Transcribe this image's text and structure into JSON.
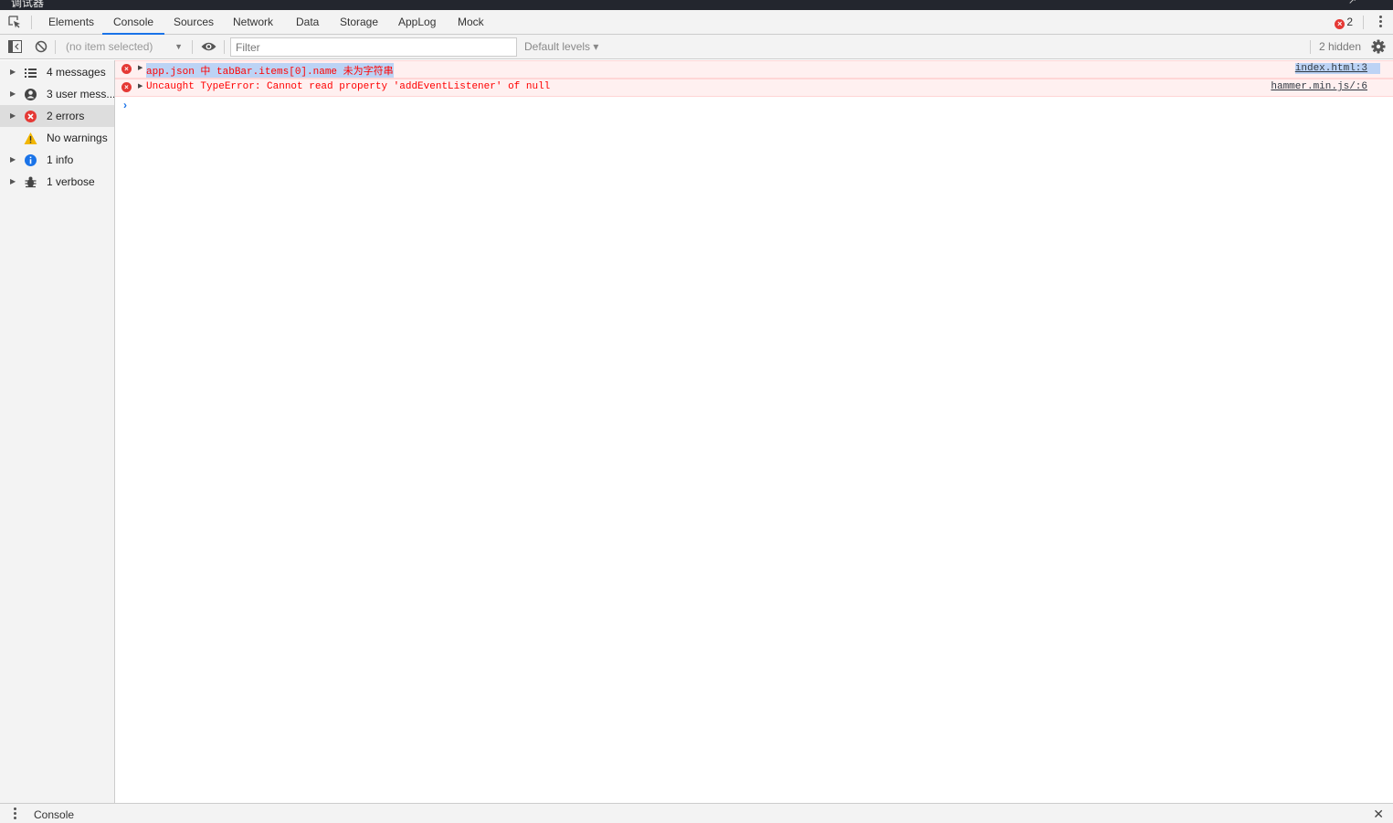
{
  "window": {
    "title": "调试器",
    "corner_glyph": "↗"
  },
  "tabs": [
    {
      "label": "Elements"
    },
    {
      "label": "Console"
    },
    {
      "label": "Sources"
    },
    {
      "label": "Network"
    },
    {
      "label": "Data"
    },
    {
      "label": "Storage"
    },
    {
      "label": "AppLog"
    },
    {
      "label": "Mock"
    }
  ],
  "active_tab": "Console",
  "error_badge": {
    "count": "2"
  },
  "toolbar": {
    "context": "(no item selected)",
    "filter_placeholder": "Filter",
    "levels": "Default levels ▾",
    "hidden": "2 hidden"
  },
  "sidebar": {
    "items": [
      {
        "label": "4 messages",
        "icon": "list-icon"
      },
      {
        "label": "3 user mess...",
        "icon": "user-icon"
      },
      {
        "label": "2 errors",
        "icon": "error-icon"
      },
      {
        "label": "No warnings",
        "icon": "warning-icon"
      },
      {
        "label": "1 info",
        "icon": "info-icon"
      },
      {
        "label": "1 verbose",
        "icon": "bug-icon"
      }
    ],
    "selected": "2 errors"
  },
  "messages": [
    {
      "text": "app.json 中 tabBar.items[0].name 未为字符串",
      "source": "index.html:3"
    },
    {
      "text": "Uncaught TypeError: Cannot read property 'addEventListener' of null",
      "source": "hammer.min.js/:6"
    }
  ],
  "drawer": {
    "title": "Console"
  },
  "colors": {
    "accent": "#1a73e8",
    "error": "#e53935",
    "error_bg": "#fff0f0",
    "selection": "#bcd3f5"
  }
}
